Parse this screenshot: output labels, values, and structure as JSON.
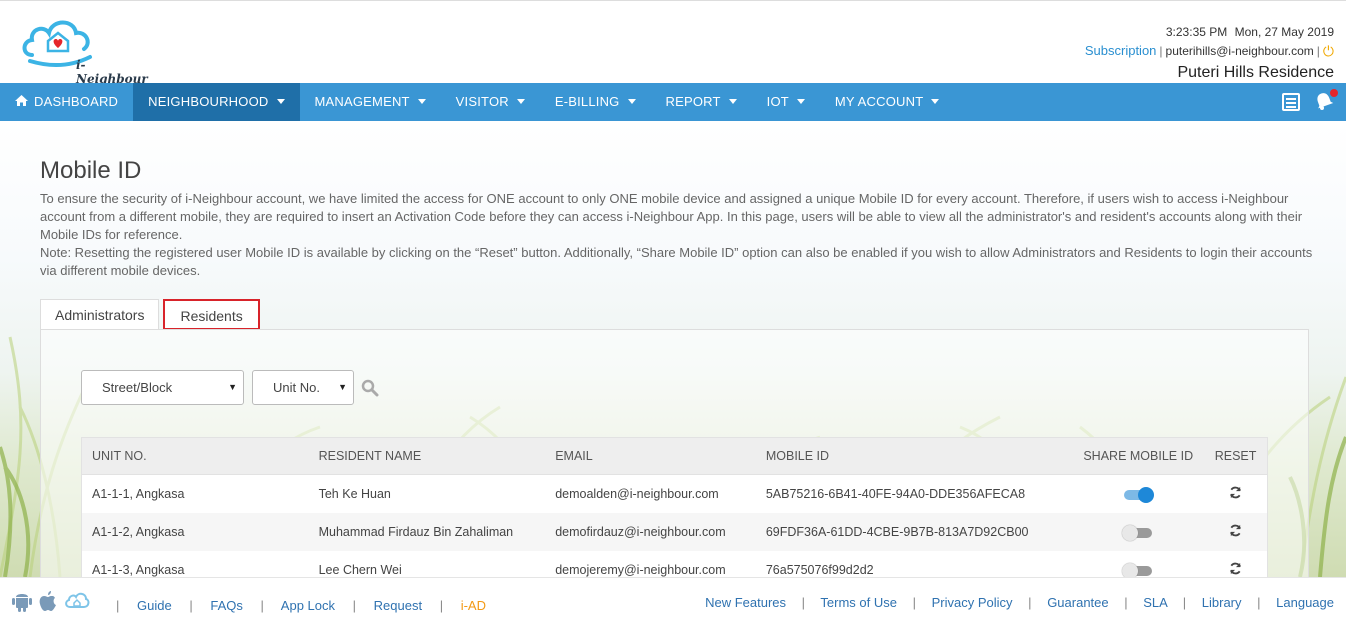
{
  "brand": {
    "logo_text": "i-Neighbour"
  },
  "header": {
    "time": "3:23:35 PM",
    "date": "Mon, 27 May 2019",
    "subscription_label": "Subscription",
    "user_email": "puterihills@i-neighbour.com",
    "residence": "Puteri Hills Residence"
  },
  "nav": {
    "items": [
      {
        "label": "DASHBOARD"
      },
      {
        "label": "NEIGHBOURHOOD"
      },
      {
        "label": "MANAGEMENT"
      },
      {
        "label": "VISITOR"
      },
      {
        "label": "E-BILLING"
      },
      {
        "label": "REPORT"
      },
      {
        "label": "IOT"
      },
      {
        "label": "MY ACCOUNT"
      }
    ]
  },
  "page": {
    "title": "Mobile ID",
    "description": "To ensure the security of i-Neighbour account, we have limited the access for ONE account to only ONE mobile device and assigned a unique Mobile ID for every account. Therefore, if users wish to access i-Neighbour account from a different mobile, they are required to insert an Activation Code before they can access i-Neighbour App. In this page, users will be able to view all the administrator's and resident's accounts along with their Mobile IDs for reference.",
    "note": "Note: Resetting the registered user Mobile ID is available by clicking on the “Reset” button. Additionally, “Share Mobile ID” option can also be enabled if you wish to allow Administrators and Residents to login their accounts via different mobile devices."
  },
  "tabs": [
    {
      "label": "Administrators"
    },
    {
      "label": "Residents"
    }
  ],
  "filters": {
    "street_block": "Street/Block",
    "unit_no": "Unit No."
  },
  "table": {
    "headers": [
      "UNIT NO.",
      "RESIDENT NAME",
      "EMAIL",
      "MOBILE ID",
      "SHARE MOBILE ID",
      "RESET"
    ],
    "rows": [
      {
        "unit": "A1-1-1, Angkasa",
        "name": "Teh Ke Huan",
        "email": "demoalden@i-neighbour.com",
        "mobile_id": "5AB75216-6B41-40FE-94A0-DDE356AFECA8",
        "share": true
      },
      {
        "unit": "A1-1-2, Angkasa",
        "name": "Muhammad Firdauz Bin Zahaliman",
        "email": "demofirdauz@i-neighbour.com",
        "mobile_id": "69FDF36A-61DD-4CBE-9B7B-813A7D92CB00",
        "share": false
      },
      {
        "unit": "A1-1-3, Angkasa",
        "name": "Lee Chern Wei",
        "email": "demojeremy@i-neighbour.com",
        "mobile_id": "76a575076f99d2d2",
        "share": false
      }
    ]
  },
  "footer": {
    "left_links": [
      "Guide",
      "FAQs",
      "App Lock",
      "Request",
      "i-AD"
    ],
    "right_links": [
      "New Features",
      "Terms of Use",
      "Privacy Policy",
      "Guarantee",
      "SLA",
      "Library",
      "Language"
    ]
  },
  "colors": {
    "nav_bg": "#3a96d4",
    "nav_active": "#1f6fa8",
    "link": "#2f72b0",
    "accent_orange": "#f39a16",
    "tab_highlight": "#d8232a"
  }
}
